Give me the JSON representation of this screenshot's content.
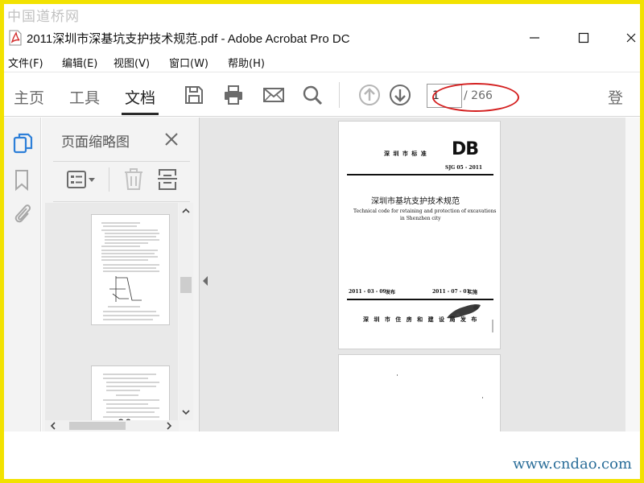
{
  "watermarks": {
    "top": "中国道桥网",
    "bottom": "www.cndao.com"
  },
  "window": {
    "title": "2011深圳市深基坑支护技术规范.pdf - Adobe Acrobat Pro DC"
  },
  "menu": [
    "文件(F)",
    "编辑(E)",
    "视图(V)",
    "窗口(W)",
    "帮助(H)"
  ],
  "toolbar": {
    "tabs": [
      "主页",
      "工具",
      "文档"
    ],
    "active_tab": "文档",
    "page_current": "1",
    "page_total": "/ 266",
    "login_partial": "登"
  },
  "panel": {
    "title": "页面缩略图",
    "thumb_page_label": "90"
  },
  "document": {
    "cover": {
      "standard_label": "深 圳 市 标 准",
      "db_logo": "DB",
      "code": "SJG 05 - 2011",
      "title_cn": "深圳市基坑支护技术规范",
      "title_en_line1": "Technical code for retaining and protection of excavations",
      "title_en_line2": "in Shenzhen city",
      "issue_date": "2011 - 03 - 09",
      "issue_word": "发布",
      "effective_date": "2011 - 07 - 01",
      "effective_word": "实施",
      "publisher": "深 圳 市 住 房 和 建 设 局 发 布"
    }
  },
  "colors": {
    "accent_blue": "#2d7fd8",
    "highlight_red": "#d42020",
    "icon_gray": "#6b6b6b"
  },
  "icons": [
    "pdf-file-icon",
    "minimize-icon",
    "maximize-icon",
    "close-icon",
    "save-icon",
    "print-icon",
    "mail-icon",
    "search-icon",
    "page-up-icon",
    "page-down-icon",
    "thumbnails-icon",
    "bookmark-icon",
    "attachment-icon",
    "options-icon",
    "delete-icon",
    "extract-icon",
    "collapse-arrow-icon"
  ]
}
